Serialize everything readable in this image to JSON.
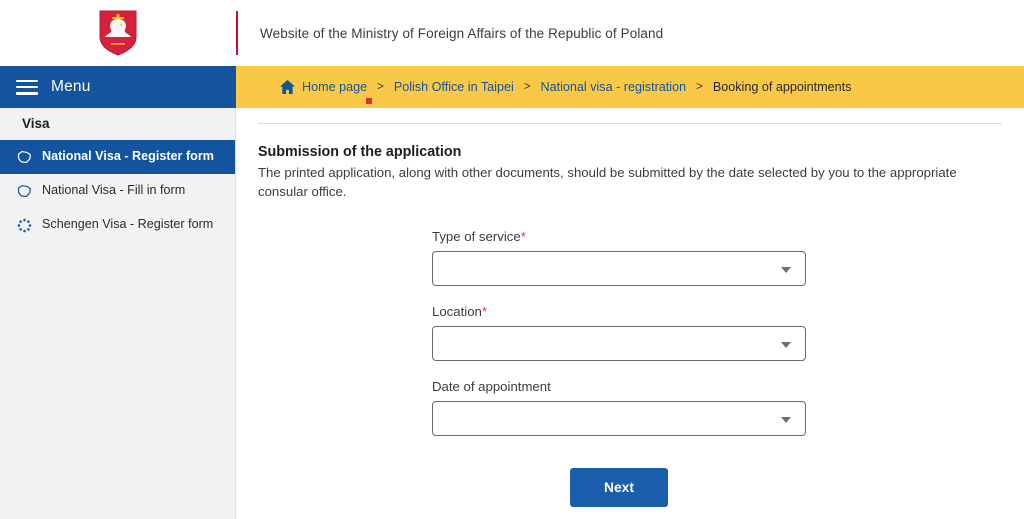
{
  "header": {
    "emblem_name": "poland-coat-of-arms",
    "title": "Website of the Ministry of Foreign Affairs of the Republic of Poland",
    "divider_color": "#c8102e"
  },
  "menu": {
    "label": "Menu",
    "icon": "hamburger-icon",
    "bar_color": "#14549f"
  },
  "breadcrumb": {
    "bar_color": "#f9c846",
    "home_icon": "home-icon",
    "separator": ">",
    "items": [
      {
        "label": "Home page",
        "current": false
      },
      {
        "label": "Polish Office in Taipei",
        "current": false
      },
      {
        "label": "National visa - registration",
        "current": false
      },
      {
        "label": "Booking of appointments",
        "current": true
      }
    ]
  },
  "sidebar": {
    "heading": "Visa",
    "background": "#f2f2f2",
    "active_color": "#14549f",
    "items": [
      {
        "label": "National Visa -  Register form",
        "icon": "poland-map-icon",
        "active": true
      },
      {
        "label": "National Visa -  Fill in form",
        "icon": "poland-map-icon",
        "active": false
      },
      {
        "label": "Schengen Visa -  Register form",
        "icon": "eu-stars-icon",
        "active": false
      }
    ]
  },
  "main": {
    "section_title": "Submission of the application",
    "section_description": "The printed application, along with other documents, should be submitted by the date selected by you to the appropriate consular office.",
    "fields": [
      {
        "label": "Type of service",
        "required": true,
        "value": "",
        "icon": "chevron-down-icon"
      },
      {
        "label": "Location",
        "required": true,
        "value": "",
        "icon": "chevron-down-icon"
      },
      {
        "label": "Date of appointment",
        "required": false,
        "value": "",
        "icon": "chevron-down-icon"
      }
    ],
    "required_marker": "*",
    "next_button": "Next",
    "next_button_color": "#1a5fad"
  }
}
